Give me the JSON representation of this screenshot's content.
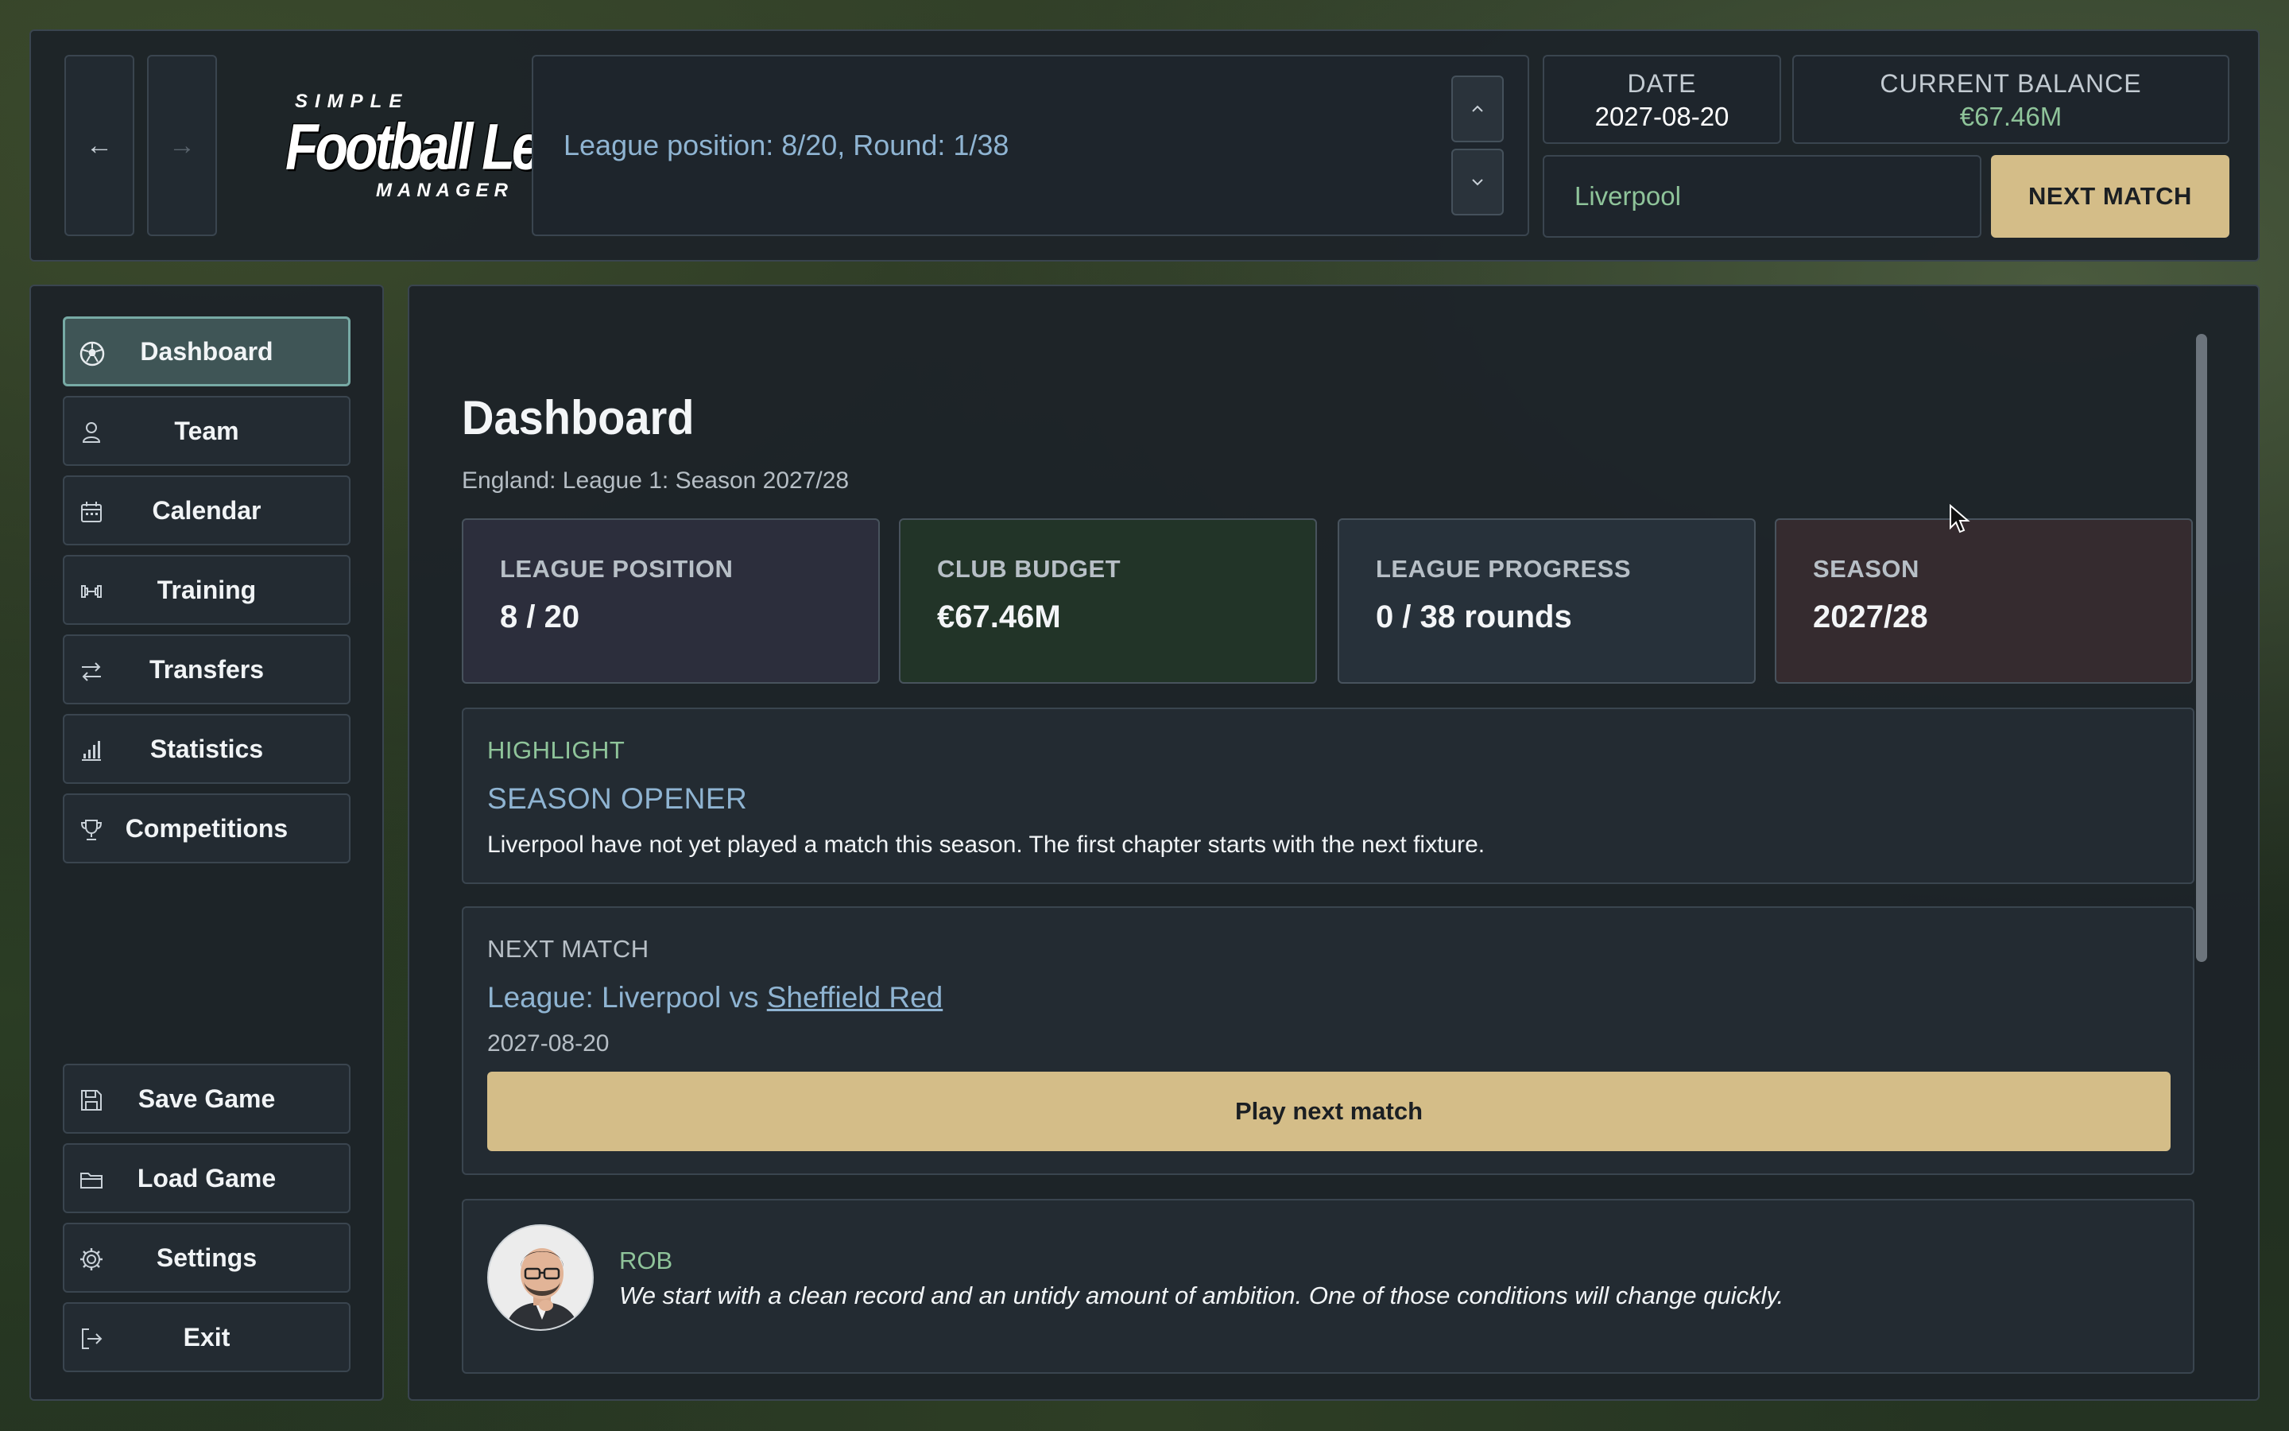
{
  "topbar": {
    "back_icon": "←",
    "forward_icon": "→",
    "logo": {
      "line1": "SIMPLE",
      "line2": "Football League",
      "line3": "MANAGER"
    },
    "news_text": "League position: 8/20, Round: 1/38",
    "news_up_icon": "⌃",
    "news_down_icon": "⌄",
    "date_label": "DATE",
    "date_value": "2027-08-20",
    "balance_label": "CURRENT BALANCE",
    "balance_value": "€67.46M",
    "club_name": "Liverpool",
    "next_match_label": "NEXT MATCH"
  },
  "sidebar": {
    "items": [
      {
        "label": "Dashboard",
        "icon": "soccer-ball-icon"
      },
      {
        "label": "Team",
        "icon": "person-icon"
      },
      {
        "label": "Calendar",
        "icon": "calendar-icon"
      },
      {
        "label": "Training",
        "icon": "dumbbell-icon"
      },
      {
        "label": "Transfers",
        "icon": "arrows-exchange-icon"
      },
      {
        "label": "Statistics",
        "icon": "bar-chart-icon"
      },
      {
        "label": "Competitions",
        "icon": "trophy-icon"
      }
    ],
    "bottom_items": [
      {
        "label": "Save Game",
        "icon": "floppy-disk-icon"
      },
      {
        "label": "Load Game",
        "icon": "folder-icon"
      },
      {
        "label": "Settings",
        "icon": "gear-icon"
      },
      {
        "label": "Exit",
        "icon": "logout-icon"
      }
    ]
  },
  "main": {
    "title": "Dashboard",
    "subtitle": "England: League 1: Season 2027/28",
    "cards": [
      {
        "label": "LEAGUE POSITION",
        "value": "8 / 20"
      },
      {
        "label": "CLUB BUDGET",
        "value": "€67.46M"
      },
      {
        "label": "LEAGUE PROGRESS",
        "value": "0 / 38 rounds"
      },
      {
        "label": "SEASON",
        "value": "2027/28"
      }
    ],
    "highlight": {
      "kicker": "HIGHLIGHT",
      "title": "SEASON OPENER",
      "body": "Liverpool have not yet played a match this season. The first chapter starts with the next fixture."
    },
    "next_match": {
      "kicker": "NEXT MATCH",
      "prefix": "League: Liverpool vs ",
      "opponent": "Sheffield Red",
      "date": "2027-08-20",
      "play_label": "Play next match"
    },
    "quote": {
      "name": "ROB",
      "text": "We start with a clean record and an untidy amount of ambition. One of those conditions will change quickly."
    }
  },
  "colors": {
    "accent_gold": "#d4bd88",
    "accent_green": "#8fc49a",
    "accent_blue": "#8fb4d2",
    "active_teal": "#77aaa5"
  }
}
